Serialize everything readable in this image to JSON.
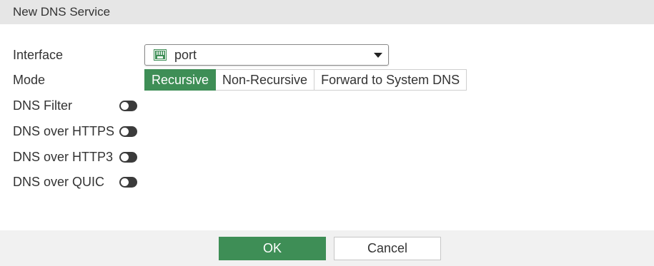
{
  "dialog": {
    "title": "New DNS Service"
  },
  "form": {
    "interface": {
      "label": "Interface",
      "value": "port",
      "icon": "network-port-icon"
    },
    "mode": {
      "label": "Mode",
      "options": [
        "Recursive",
        "Non-Recursive",
        "Forward to System DNS"
      ],
      "selected": "Recursive"
    },
    "toggles": [
      {
        "label": "DNS Filter",
        "enabled": false
      },
      {
        "label": "DNS over HTTPS",
        "enabled": false
      },
      {
        "label": "DNS over HTTP3",
        "enabled": false
      },
      {
        "label": "DNS over QUIC",
        "enabled": false
      }
    ]
  },
  "footer": {
    "ok_label": "OK",
    "cancel_label": "Cancel"
  },
  "colors": {
    "accent": "#3e8e56",
    "header_bg": "#e6e6e6",
    "footer_bg": "#f1f1f1",
    "toggle_off": "#3b3b3b"
  }
}
